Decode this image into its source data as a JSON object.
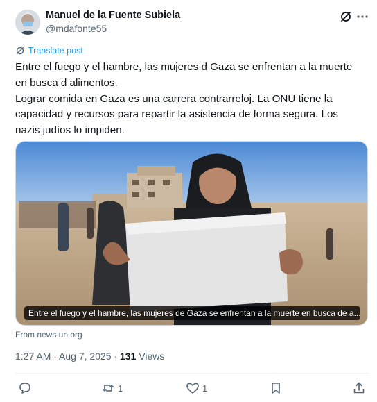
{
  "author": {
    "name": "Manuel de la Fuente Subiela",
    "handle": "@mdafonte55"
  },
  "translate": {
    "label": "Translate post"
  },
  "tweet": {
    "lines": [
      "Entre el fuego y el hambre, las mujeres d Gaza se enfrentan a la muerte",
      "en busca d alimentos.",
      "Lograr comida en Gaza es una carrera contrarreloj. La ONU tiene la",
      "capacidad y recursos para repartir la asistencia de forma segura. Los",
      "nazis judíos lo impiden."
    ]
  },
  "media": {
    "caption": "Entre el fuego y el hambre, las mujeres de Gaza se enfrentan a la muerte en busca de a..."
  },
  "link_source": "From news.un.org",
  "meta": {
    "time": "1:27 AM",
    "separator": " · ",
    "date": "Aug 7, 2025",
    "views_count": "131",
    "views_label": " Views"
  },
  "actions": {
    "reply_count": "",
    "repost_count": "1",
    "like_count": "1"
  },
  "icons": {
    "grok": "grok-icon",
    "more": "more-icon",
    "translate": "translate-icon",
    "reply": "reply-icon",
    "repost": "repost-icon",
    "like": "like-icon",
    "bookmark": "bookmark-icon",
    "share": "share-icon"
  },
  "colors": {
    "accent": "#1d9bf0",
    "secondary_text": "#536471",
    "primary_text": "#0f1419"
  }
}
